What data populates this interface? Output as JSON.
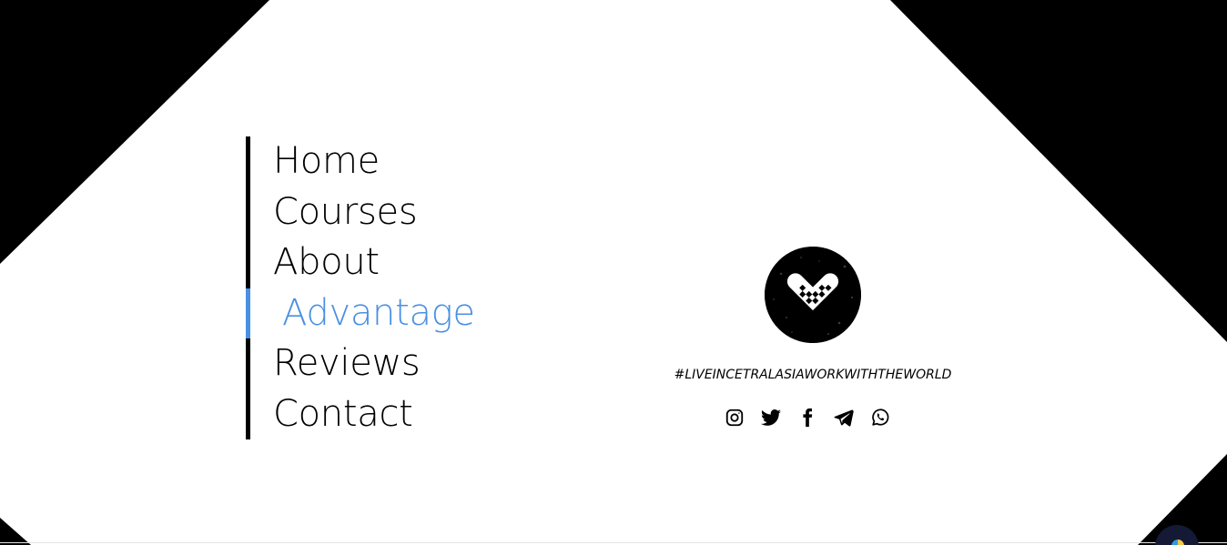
{
  "nav": {
    "items": [
      {
        "label": "Home",
        "active": false
      },
      {
        "label": "Courses",
        "active": false
      },
      {
        "label": "About",
        "active": false
      },
      {
        "label": "Advantage",
        "active": true
      },
      {
        "label": "Reviews",
        "active": false
      },
      {
        "label": "Contact",
        "active": false
      }
    ]
  },
  "brand": {
    "logo_icon": "heart-grid-logo",
    "hashtag": "#LIVEINCETRALASIAWORKWITHTHEWORLD"
  },
  "socials": [
    {
      "name": "instagram-icon"
    },
    {
      "name": "twitter-icon"
    },
    {
      "name": "facebook-icon"
    },
    {
      "name": "telegram-icon"
    },
    {
      "name": "whatsapp-icon"
    }
  ],
  "colors": {
    "background": "#ffffff",
    "corners": "#000000",
    "text": "#000000",
    "accent": "#4a90e2",
    "fab": "#141a35"
  }
}
